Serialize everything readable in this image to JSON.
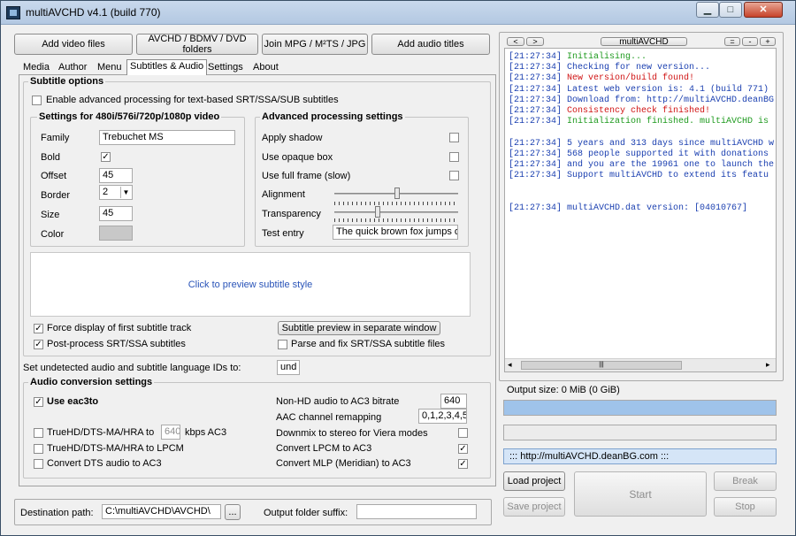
{
  "window": {
    "title": "multiAVCHD v4.1 (build 770)"
  },
  "toolbar": {
    "add_video": "Add video files",
    "avchd_folders": "AVCHD / BDMV / DVD folders",
    "join_mpg": "Join MPG / M²TS / JPG",
    "add_audio": "Add audio titles"
  },
  "tabs": [
    "Media",
    "Author",
    "Menu",
    "Subtitles & Audio",
    "Settings",
    "About"
  ],
  "subtitle_options": {
    "title": "Subtitle options",
    "enable_advanced": "Enable advanced processing for text-based SRT/SSA/SUB subtitles",
    "settings_title": "Settings for 480i/576i/720p/1080p video",
    "family_label": "Family",
    "family_value": "Trebuchet MS",
    "bold_label": "Bold",
    "bold_check": "✓",
    "offset_label": "Offset",
    "offset_value": "45",
    "border_label": "Border",
    "border_value": "2",
    "size_label": "Size",
    "size_value": "45",
    "color_label": "Color",
    "adv_title": "Advanced processing settings",
    "apply_shadow": "Apply shadow",
    "opaque_box": "Use opaque box",
    "full_frame": "Use full frame (slow)",
    "alignment": "Alignment",
    "transparency": "Transparency",
    "test_entry": "Test entry",
    "test_value": "The quick brown fox jumps over",
    "preview_text": "Click to preview subtitle style",
    "force_display": "Force display of first subtitle track",
    "force_check": "✓",
    "post_process": "Post-process SRT/SSA subtitles",
    "post_check": "✓",
    "preview_window": "Subtitle preview in separate window",
    "parse_fix": "Parse and fix SRT/SSA subtitle files"
  },
  "lang": {
    "label": "Set undetected audio and subtitle language IDs to:",
    "value": "und"
  },
  "audio": {
    "title": "Audio conversion settings",
    "eac3to": "Use eac3to",
    "eac3to_check": "✓",
    "truehd_ac3": "TrueHD/DTS-MA/HRA to",
    "kbps_value": "640",
    "kbps_label": "kbps AC3",
    "truehd_lpcm": "TrueHD/DTS-MA/HRA to LPCM",
    "dts_ac3": "Convert DTS audio to AC3",
    "nonhd_label": "Non-HD audio to AC3 bitrate",
    "nonhd_value": "640",
    "aac_label": "AAC channel remapping",
    "aac_value": "0,1,2,3,4,5",
    "downmix": "Downmix to stereo for Viera modes",
    "lpcm_ac3": "Convert LPCM to AC3",
    "lpcm_check": "✓",
    "mlp_ac3": "Convert MLP (Meridian) to AC3",
    "mlp_check": "✓"
  },
  "bottom": {
    "dest_label": "Destination path:",
    "dest_value": "C:\\multiAVCHD\\AVCHD\\",
    "browse": "...",
    "suffix_label": "Output folder suffix:"
  },
  "logpanel": {
    "nav_left": "<",
    "nav_right": ">",
    "title": "multiAVCHD",
    "ctl_eq": "=",
    "ctl_minus": "-",
    "ctl_plus": "+",
    "lines": [
      {
        "ts": "[21:27:34]",
        "msg": "Initialising...",
        "color": "#1e9a1e"
      },
      {
        "ts": "[21:27:34]",
        "msg": "Checking for new version...",
        "color": "#1a3fb0"
      },
      {
        "ts": "[21:27:34]",
        "msg": "New version/build found!",
        "color": "#d01414"
      },
      {
        "ts": "[21:27:34]",
        "msg": "Latest web version is: 4.1 (build 771)",
        "color": "#1a3fb0"
      },
      {
        "ts": "[21:27:34]",
        "msg": "Download from: http://multiAVCHD.deanBG",
        "color": "#1a3fb0"
      },
      {
        "ts": "[21:27:34]",
        "msg": "Consistency check finished!",
        "color": "#d01414"
      },
      {
        "ts": "[21:27:34]",
        "msg": "Initialization finished. multiAVCHD is",
        "color": "#1e9a1e"
      },
      {
        "ts": "",
        "msg": "",
        "color": "#000"
      },
      {
        "ts": "[21:27:34]",
        "msg": "5 years and 313 days since multiAVCHD w",
        "color": "#1a3fb0"
      },
      {
        "ts": "[21:27:34]",
        "msg": "568 people supported it with donations",
        "color": "#1a3fb0"
      },
      {
        "ts": "[21:27:34]",
        "msg": "and you are the 19961 one to launch the",
        "color": "#1a3fb0"
      },
      {
        "ts": "[21:27:34]",
        "msg": "Support multiAVCHD to extend its featu",
        "color": "#1a3fb0"
      },
      {
        "ts": "",
        "msg": "",
        "color": "#000"
      },
      {
        "ts": "",
        "msg": "",
        "color": "#000"
      },
      {
        "ts": "[21:27:34]",
        "msg": "multiAVCHD.dat version: [04010767]",
        "color": "#1a3fb0"
      }
    ],
    "output_size": "Output size: 0 MiB (0 GiB)",
    "url": "::: http://multiAVCHD.deanBG.com :::",
    "load_project": "Load project",
    "save_project": "Save project",
    "start": "Start",
    "break": "Break",
    "stop": "Stop"
  },
  "colors": {
    "progress": "#9fc3ea",
    "url_bg": "#d5e5f7"
  }
}
